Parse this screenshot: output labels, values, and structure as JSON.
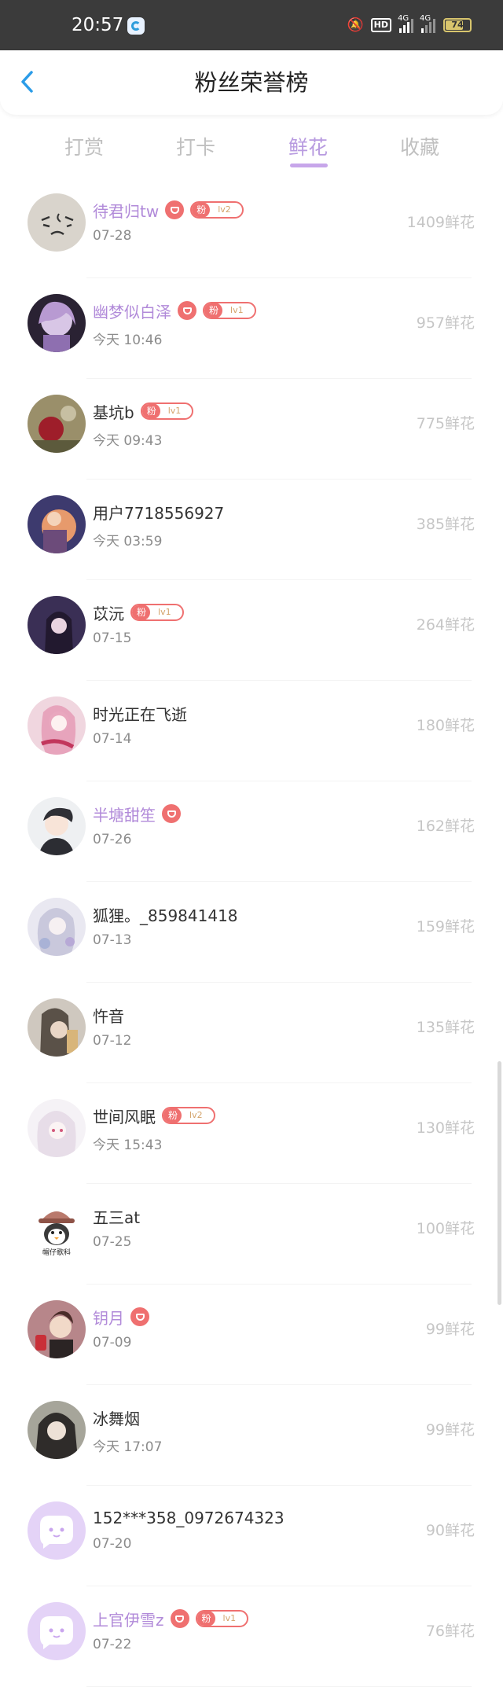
{
  "status_bar": {
    "time": "20:57",
    "hd": "HD",
    "network1": "4G",
    "network2": "4G",
    "battery": "74"
  },
  "header": {
    "title": "粉丝荣誉榜"
  },
  "tabs": [
    {
      "label": "打赏",
      "active": false
    },
    {
      "label": "打卡",
      "active": false
    },
    {
      "label": "鲜花",
      "active": true
    },
    {
      "label": "收藏",
      "active": false
    }
  ],
  "fans": [
    {
      "name": "待君归tw",
      "vip": true,
      "heart": true,
      "badge": "粉",
      "level": "lv2",
      "time": "07-28",
      "count": "1409鲜花",
      "avatar": "sketch"
    },
    {
      "name": "幽梦似白泽",
      "vip": true,
      "heart": true,
      "badge": "粉",
      "level": "lv1",
      "time": "今天 10:46",
      "count": "957鲜花",
      "avatar": "purple-anime"
    },
    {
      "name": "基坑b",
      "vip": false,
      "heart": false,
      "badge": "粉",
      "level": "lv1",
      "time": "今天 09:43",
      "count": "775鲜花",
      "avatar": "rose"
    },
    {
      "name": "用户7718556927",
      "vip": false,
      "heart": false,
      "badge": "",
      "level": "",
      "time": "今天 03:59",
      "count": "385鲜花",
      "avatar": "sunset"
    },
    {
      "name": "苡沅",
      "vip": false,
      "heart": false,
      "badge": "粉",
      "level": "lv1",
      "time": "07-15",
      "count": "264鲜花",
      "avatar": "night-girl"
    },
    {
      "name": "时光正在飞逝",
      "vip": false,
      "heart": false,
      "badge": "",
      "level": "",
      "time": "07-14",
      "count": "180鲜花",
      "avatar": "pink-anime"
    },
    {
      "name": "半塘甜笙",
      "vip": true,
      "heart": true,
      "badge": "",
      "level": "",
      "time": "07-26",
      "count": "162鲜花",
      "avatar": "boy-anime"
    },
    {
      "name": "狐狸。_859841418",
      "vip": false,
      "heart": false,
      "badge": "",
      "level": "",
      "time": "07-13",
      "count": "159鲜花",
      "avatar": "white-anime"
    },
    {
      "name": "忤音",
      "vip": false,
      "heart": false,
      "badge": "",
      "level": "",
      "time": "07-12",
      "count": "135鲜花",
      "avatar": "gray-girl"
    },
    {
      "name": "世间风眠",
      "vip": false,
      "heart": false,
      "badge": "粉",
      "level": "lv2",
      "time": "今天 15:43",
      "count": "130鲜花",
      "avatar": "pale-anime"
    },
    {
      "name": "五三at",
      "vip": false,
      "heart": false,
      "badge": "",
      "level": "",
      "time": "07-25",
      "count": "100鲜花",
      "avatar": "penguin"
    },
    {
      "name": "钥月",
      "vip": true,
      "heart": true,
      "badge": "",
      "level": "",
      "time": "07-09",
      "count": "99鲜花",
      "avatar": "brown-girl"
    },
    {
      "name": "冰舞烟",
      "vip": false,
      "heart": false,
      "badge": "",
      "level": "",
      "time": "今天 17:07",
      "count": "99鲜花",
      "avatar": "dark-anime"
    },
    {
      "name": "152***358_0972674323",
      "vip": false,
      "heart": false,
      "badge": "",
      "level": "",
      "time": "07-20",
      "count": "90鲜花",
      "avatar": "default"
    },
    {
      "name": "上官伊雪z",
      "vip": true,
      "heart": true,
      "badge": "粉",
      "level": "lv1",
      "time": "07-22",
      "count": "76鲜花",
      "avatar": "default"
    }
  ],
  "penguin_caption": "帽仔歌科"
}
